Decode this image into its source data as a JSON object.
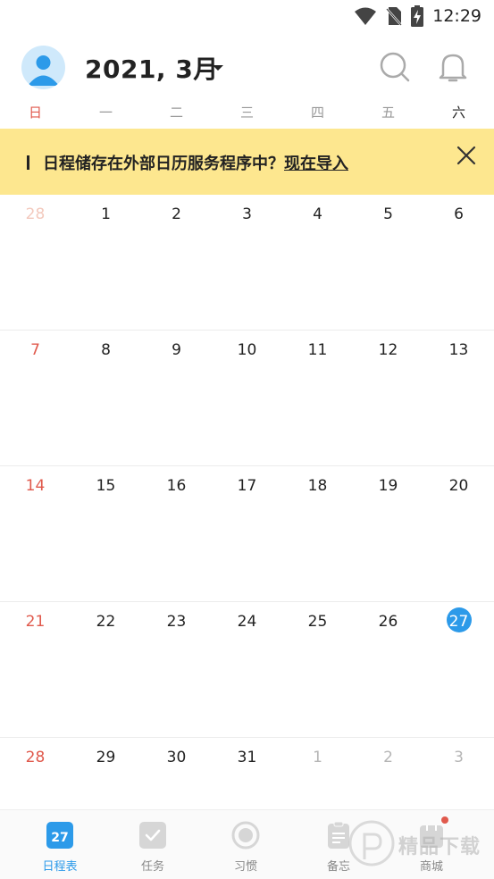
{
  "status_bar": {
    "time": "12:29"
  },
  "header": {
    "month_title": "2021, 3月"
  },
  "weekdays": [
    "日",
    "一",
    "二",
    "三",
    "四",
    "五",
    "六"
  ],
  "banner": {
    "text": "日程储存在外部日历服务程序中？",
    "link": "现在导入"
  },
  "weeks": [
    [
      {
        "d": "28",
        "s": "faded-sun"
      },
      {
        "d": "1",
        "s": ""
      },
      {
        "d": "2",
        "s": ""
      },
      {
        "d": "3",
        "s": ""
      },
      {
        "d": "4",
        "s": ""
      },
      {
        "d": "5",
        "s": ""
      },
      {
        "d": "6",
        "s": ""
      }
    ],
    [
      {
        "d": "7",
        "s": "sun"
      },
      {
        "d": "8",
        "s": ""
      },
      {
        "d": "9",
        "s": ""
      },
      {
        "d": "10",
        "s": ""
      },
      {
        "d": "11",
        "s": ""
      },
      {
        "d": "12",
        "s": ""
      },
      {
        "d": "13",
        "s": ""
      }
    ],
    [
      {
        "d": "14",
        "s": "sun"
      },
      {
        "d": "15",
        "s": ""
      },
      {
        "d": "16",
        "s": ""
      },
      {
        "d": "17",
        "s": ""
      },
      {
        "d": "18",
        "s": ""
      },
      {
        "d": "19",
        "s": ""
      },
      {
        "d": "20",
        "s": ""
      }
    ],
    [
      {
        "d": "21",
        "s": "sun"
      },
      {
        "d": "22",
        "s": ""
      },
      {
        "d": "23",
        "s": ""
      },
      {
        "d": "24",
        "s": ""
      },
      {
        "d": "25",
        "s": ""
      },
      {
        "d": "26",
        "s": ""
      },
      {
        "d": "27",
        "s": "today"
      }
    ],
    [
      {
        "d": "28",
        "s": "sun"
      },
      {
        "d": "29",
        "s": ""
      },
      {
        "d": "30",
        "s": ""
      },
      {
        "d": "31",
        "s": ""
      },
      {
        "d": "1",
        "s": "faded"
      },
      {
        "d": "2",
        "s": "faded"
      },
      {
        "d": "3",
        "s": "faded"
      }
    ]
  ],
  "bottom_nav": [
    {
      "label": "日程表",
      "icon": "calendar-icon",
      "icon_text": "27",
      "active": true
    },
    {
      "label": "任务",
      "icon": "task-check-icon",
      "active": false
    },
    {
      "label": "习惯",
      "icon": "habit-circle-icon",
      "active": false
    },
    {
      "label": "备忘",
      "icon": "memo-clipboard-icon",
      "active": false
    },
    {
      "label": "商城",
      "icon": "store-icon",
      "active": false
    }
  ],
  "watermark": {
    "text": "精品下载"
  },
  "colors": {
    "accent": "#2c9ae9",
    "sunday": "#e0594c",
    "banner_bg": "#fde78f"
  }
}
